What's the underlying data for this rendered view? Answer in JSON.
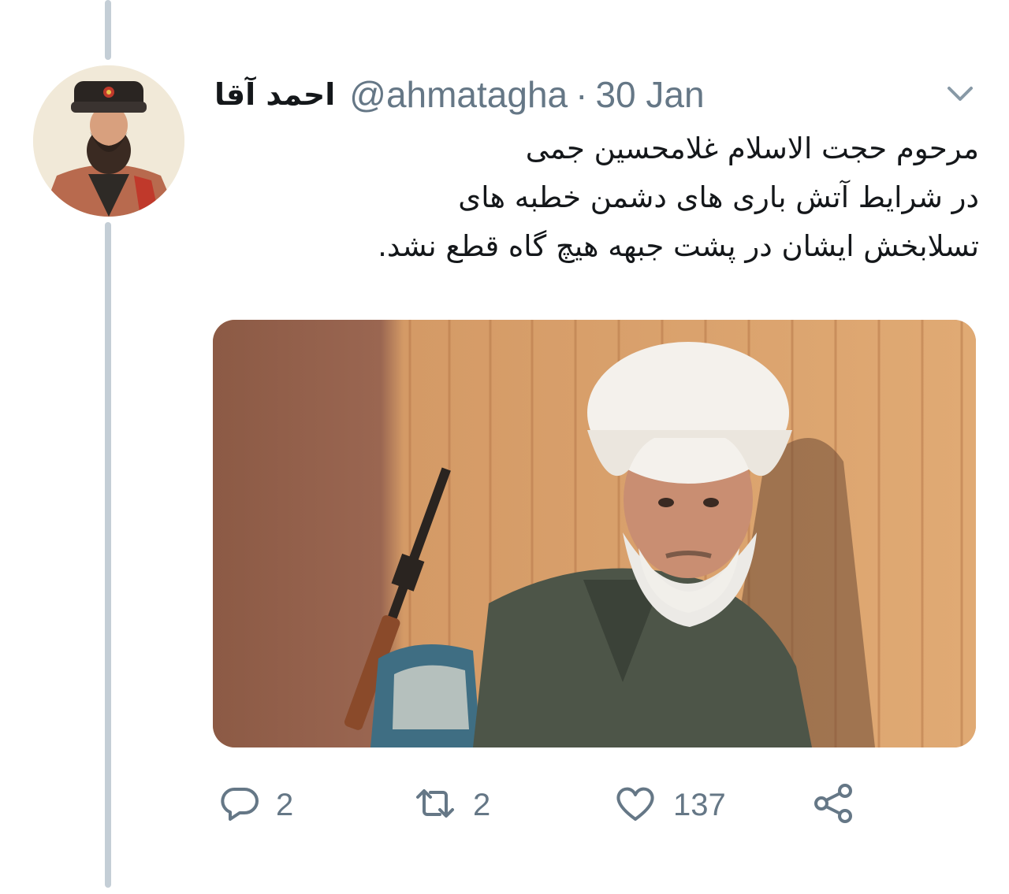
{
  "tweet": {
    "display_name": "احمد آقا",
    "handle": "@ahmatagha",
    "separator": "·",
    "date": "30 Jan",
    "text_lines": [
      "مرحوم حجت الاسلام غلامحسین جمی",
      "در شرایط آتش باری های دشمن خطبه های",
      "تسلابخش ایشان در پشت جبهه هیچ گاه قطع نشد."
    ],
    "icons": {
      "more": "chevron-down-icon",
      "reply": "reply-icon",
      "retweet": "retweet-icon",
      "like": "heart-icon",
      "share": "share-icon"
    },
    "actions": {
      "reply_count": "2",
      "retweet_count": "2",
      "like_count": "137"
    }
  },
  "colors": {
    "text": "#14171a",
    "secondary": "#657786",
    "thread_line": "#c4ced6"
  }
}
